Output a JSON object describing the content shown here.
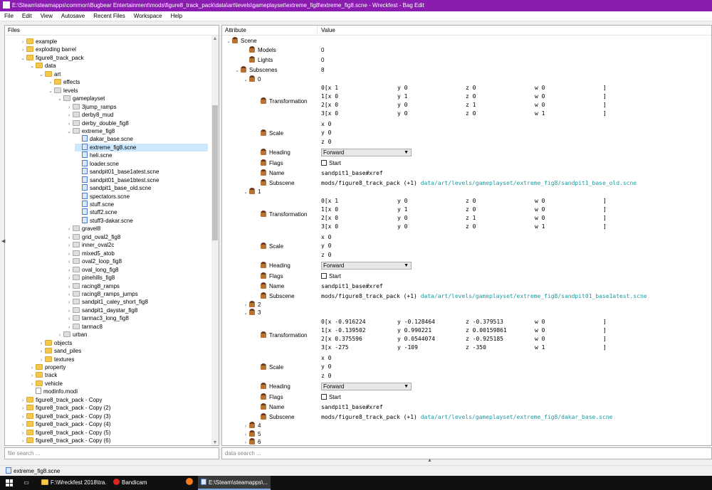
{
  "window": {
    "title": "E:\\Steam\\steamapps\\common\\Bugbear Entertainment\\mods\\figure8_track_pack\\data\\art\\levels\\gameplayset\\extreme_fig8\\extreme_fig8.scne - Wreckfest - Bag Edit"
  },
  "menu": [
    "File",
    "Edit",
    "View",
    "Autosave",
    "Recent Files",
    "Workspace",
    "Help"
  ],
  "files": {
    "header": "Files",
    "search_placeholder": "file search ...",
    "tree": [
      {
        "label": "example",
        "icon": "folder",
        "chev": ">"
      },
      {
        "label": "exploding barrel",
        "icon": "folder",
        "chev": ">"
      },
      {
        "label": "figure8_track_pack",
        "icon": "folder",
        "chev": "v"
      },
      {
        "label": "data",
        "icon": "folder",
        "chev": "v"
      },
      {
        "label": "art",
        "icon": "folder",
        "chev": "v"
      },
      {
        "label": "effects",
        "icon": "folder",
        "chev": ">"
      },
      {
        "label": "levels",
        "icon": "folder-gray",
        "chev": "v"
      },
      {
        "label": "gameplayset",
        "icon": "folder-gray",
        "chev": "v"
      },
      {
        "label": "3jump_ramps",
        "icon": "folder-gray",
        "chev": ">"
      },
      {
        "label": "derby8_mud",
        "icon": "folder-gray",
        "chev": ">"
      },
      {
        "label": "derby_double_fig8",
        "icon": "folder-gray",
        "chev": ">"
      },
      {
        "label": "extreme_fig8",
        "icon": "folder-gray",
        "chev": "v"
      },
      {
        "label": "dakar_base.scne",
        "icon": "file",
        "chev": ""
      },
      {
        "label": "extreme_fig8.scne",
        "icon": "file",
        "chev": "",
        "selected": true
      },
      {
        "label": "heli.scne",
        "icon": "file",
        "chev": ""
      },
      {
        "label": "loader.scne",
        "icon": "file",
        "chev": ""
      },
      {
        "label": "sandpit01_base1atest.scne",
        "icon": "file",
        "chev": ""
      },
      {
        "label": "sandpit01_base1btest.scne",
        "icon": "file",
        "chev": ""
      },
      {
        "label": "sandpit1_base_old.scne",
        "icon": "file",
        "chev": ""
      },
      {
        "label": "spectators.scne",
        "icon": "file",
        "chev": ""
      },
      {
        "label": "stuff.scne",
        "icon": "file",
        "chev": ""
      },
      {
        "label": "stuff2.scne",
        "icon": "file",
        "chev": ""
      },
      {
        "label": "stuff3-dakar.scne",
        "icon": "file",
        "chev": ""
      },
      {
        "label": "gravel8",
        "icon": "folder-gray",
        "chev": ">"
      },
      {
        "label": "grid_oval2_fig8",
        "icon": "folder-gray",
        "chev": ">"
      },
      {
        "label": "inner_oval2c",
        "icon": "folder-gray",
        "chev": ">"
      },
      {
        "label": "mixed5_atob",
        "icon": "folder-gray",
        "chev": ">"
      },
      {
        "label": "oval2_loop_fig8",
        "icon": "folder-gray",
        "chev": ">"
      },
      {
        "label": "oval_long_fig8",
        "icon": "folder-gray",
        "chev": ">"
      },
      {
        "label": "pinehills_fig8",
        "icon": "folder-gray",
        "chev": ">"
      },
      {
        "label": "racing8_ramps",
        "icon": "folder-gray",
        "chev": ">"
      },
      {
        "label": "racing8_ramps_jumps",
        "icon": "folder-gray",
        "chev": ">"
      },
      {
        "label": "sandpit1_caley_short_fig8",
        "icon": "folder-gray",
        "chev": ">"
      },
      {
        "label": "sandpit1_daystar_fig8",
        "icon": "folder-gray",
        "chev": ">"
      },
      {
        "label": "tarmac3_long_fig8",
        "icon": "folder-gray",
        "chev": ">"
      },
      {
        "label": "tarmac8",
        "icon": "folder-gray",
        "chev": ">"
      },
      {
        "label": "urban",
        "icon": "folder-gray",
        "chev": ">"
      },
      {
        "label": "objects",
        "icon": "folder",
        "chev": ">"
      },
      {
        "label": "sand_piles",
        "icon": "folder",
        "chev": ">"
      },
      {
        "label": "textures",
        "icon": "folder",
        "chev": ">"
      },
      {
        "label": "property",
        "icon": "folder",
        "chev": ">"
      },
      {
        "label": "track",
        "icon": "folder",
        "chev": ">"
      },
      {
        "label": "vehicle",
        "icon": "folder",
        "chev": ">"
      },
      {
        "label": "modinfo.modi",
        "icon": "file-plain",
        "chev": ""
      },
      {
        "label": "figure8_track_pack - Copy",
        "icon": "folder",
        "chev": ">"
      },
      {
        "label": "figure8_track_pack - Copy (2)",
        "icon": "folder",
        "chev": ">"
      },
      {
        "label": "figure8_track_pack - Copy (3)",
        "icon": "folder",
        "chev": ">"
      },
      {
        "label": "figure8_track_pack - Copy (4)",
        "icon": "folder",
        "chev": ">"
      },
      {
        "label": "figure8_track_pack - Copy (5)",
        "icon": "folder",
        "chev": ">"
      },
      {
        "label": "figure8_track_pack - Copy (6)",
        "icon": "folder",
        "chev": ">"
      }
    ]
  },
  "attributes": {
    "col_attribute": "Attribute",
    "col_value": "Value",
    "search_placeholder": "data search ...",
    "scene": "Scene",
    "models_label": "Models",
    "models_value": "0",
    "lights_label": "Lights",
    "lights_value": "0",
    "subscenes_label": "Subscenes",
    "subscenes_value": "8",
    "labels": {
      "transformation": "Transformation",
      "scale": "Scale",
      "heading": "Heading",
      "flags": "Flags",
      "name": "Name",
      "subscene": "Subscene",
      "heading_value": "Forward",
      "flag_start": "Start",
      "close_bracket": "]"
    },
    "s0": {
      "index": "0",
      "matrix": [
        [
          "0[x 1",
          "y 0",
          "z 0",
          "w 0"
        ],
        [
          "1[x 0",
          "y 1",
          "z 0",
          "w 0"
        ],
        [
          "2[x 0",
          "y 0",
          "z 1",
          "w 0"
        ],
        [
          "3[x 0",
          "y 0",
          "z 0",
          "w 1"
        ]
      ],
      "scale": [
        "x 0",
        "y 0",
        "z 0"
      ],
      "name": "sandpit1_base#xref",
      "subscene_prefix": "mods/figure8_track_pack (+1)",
      "subscene_path": "data/art/levels/gameplayset/extreme_fig8/sandpit1_base_old.scne"
    },
    "s1": {
      "index": "1",
      "matrix": [
        [
          "0[x 1",
          "y 0",
          "z 0",
          "w 0"
        ],
        [
          "1[x 0",
          "y 1",
          "z 0",
          "w 0"
        ],
        [
          "2[x 0",
          "y 0",
          "z 1",
          "w 0"
        ],
        [
          "3[x 0",
          "y 0",
          "z 0",
          "w 1"
        ]
      ],
      "scale": [
        "x 0",
        "y 0",
        "z 0"
      ],
      "name": "sandpit1_base#xref",
      "subscene_prefix": "mods/figure8_track_pack (+1)",
      "subscene_path": "data/art/levels/gameplayset/extreme_fig8/sandpit01_base1atest.scne"
    },
    "s2_index": "2",
    "s3": {
      "index": "3",
      "matrix": [
        [
          "0[x -0.916224",
          "y -0.128464",
          "z -0.379513",
          "w 0"
        ],
        [
          "1[x -0.139502",
          "y 0.990221",
          "z 0.00159861",
          "w 0"
        ],
        [
          "2[x 0.375596",
          "y 0.0544074",
          "z -0.925185",
          "w 0"
        ],
        [
          "3[x -275",
          "y -109",
          "z -350",
          "w 1"
        ]
      ],
      "scale": [
        "x 0",
        "y 0",
        "z 0"
      ],
      "name": "sandpit1_base#xref",
      "subscene_prefix": "mods/figure8_track_pack (+1)",
      "subscene_path": "data/art/levels/gameplayset/extreme_fig8/dakar_base.scne"
    },
    "s4_index": "4",
    "s5_index": "5",
    "s6_index": "6"
  },
  "status": {
    "file": "extreme_fig8.scne"
  },
  "taskbar": {
    "item1": "F:\\Wreckfest 2018\\tra...",
    "item2": "Bandicam",
    "item3": "E:\\Steam\\steamapps\\..."
  }
}
